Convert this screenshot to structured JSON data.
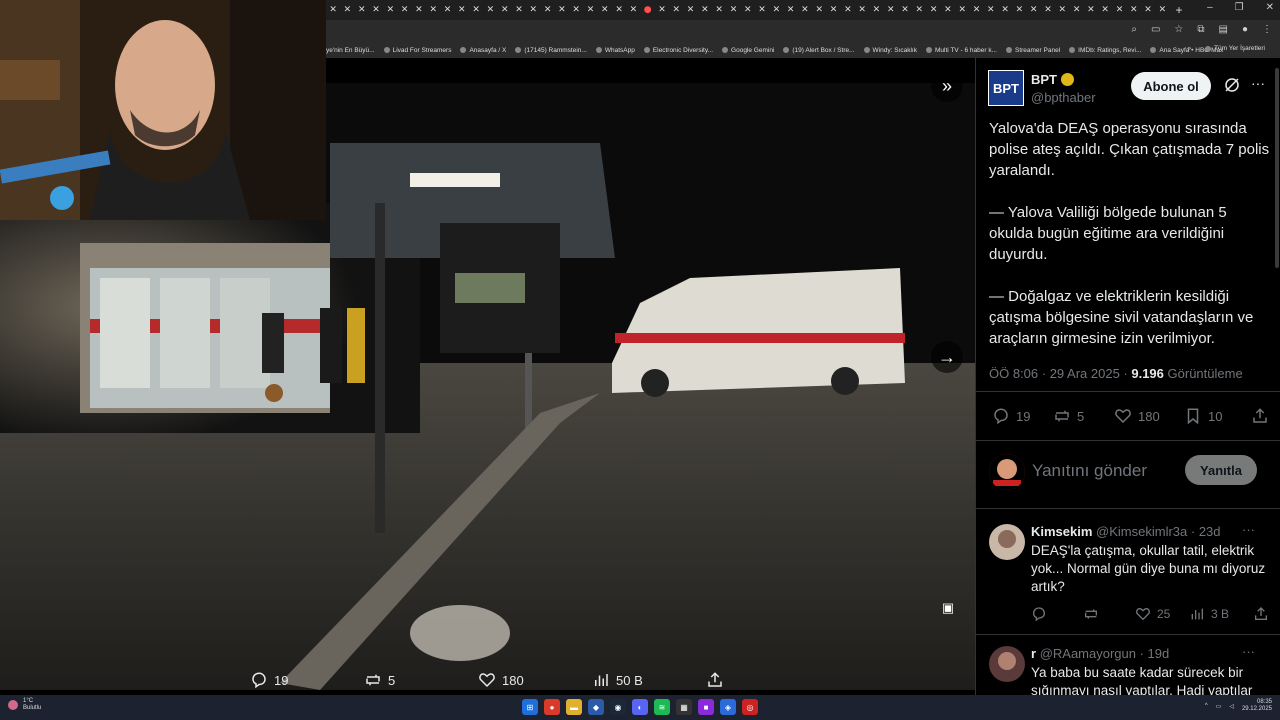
{
  "browser": {
    "tabs_count": 59,
    "active_tab_index": 22,
    "new_tab_label": "+",
    "bookmarks": [
      "ye'nin En Büyü...",
      "Livad For Streamers",
      "Anasayfa / X",
      "(17145) Rammstein...",
      "WhatsApp",
      "Electronic Diversity...",
      "Google Gemini",
      "(19) Alert Box / Stre...",
      "Windy: Sıcaklık",
      "Multi TV - 6 haber k...",
      "Streamer Panel",
      "IMDb: Ratings, Revi...",
      "Ana Sayfa • HBO Max"
    ],
    "bookmarks_overflow": "»",
    "all_bookmarks": "Tüm Yer İşaretleri"
  },
  "media": {
    "collapse_icon": "»",
    "next_icon": "→",
    "bar": {
      "replies": "19",
      "reposts": "5",
      "likes": "180",
      "views": "50 B"
    }
  },
  "post": {
    "author_name": "BPT",
    "author_handle": "@bpthaber",
    "avatar_text": "BPT",
    "follow_label": "Abone ol",
    "paragraphs": [
      "Yalova'da DEAŞ operasyonu sırasında polise ateş açıldı. Çıkan çatışmada 7 polis yaralandı.",
      "— Yalova Valiliği bölgede bulunan 5 okulda bugün eğitime ara verildiğini duyurdu.",
      "— Doğalgaz ve elektriklerin kesildiği çatışma bölgesine sivil vatandaşların ve araçların girmesine izin verilmiyor."
    ],
    "meta_time": "ÖÖ 8:06 · 29 Ara 2025 · ",
    "meta_views": "9.196",
    "meta_views_label": " Görüntüleme",
    "replies": "19",
    "reposts": "5",
    "likes": "180",
    "bookmarks": "10"
  },
  "reply": {
    "placeholder": "Yanıtını gönder",
    "button_label": "Yanıtla"
  },
  "comments": [
    {
      "name": "Kimsekim",
      "handle": "@Kimsekimlr3a",
      "age": "· 23d",
      "text": "DEAŞ'la çatışma, okullar tatil, elektrik yok... Normal gün diye buna mı diyoruz artık?",
      "likes": "25",
      "views": "3 B"
    },
    {
      "name": "r",
      "handle": "@RAamayorgun",
      "age": "· 19d",
      "text": "Ya baba bu saate kadar sürecek bir sığınmayı nasıl yaptılar. Hadi yaptılar",
      "likes": "",
      "views": ""
    }
  ],
  "taskbar": {
    "weather_temp": "1°C",
    "weather_desc": "Bulutlu",
    "time": "08:35",
    "date": "29.12.2025"
  },
  "colors": {
    "accent_follow_bg": "#eff3f4",
    "muted_text": "#71767b",
    "verified_badge": "#e2b719"
  }
}
